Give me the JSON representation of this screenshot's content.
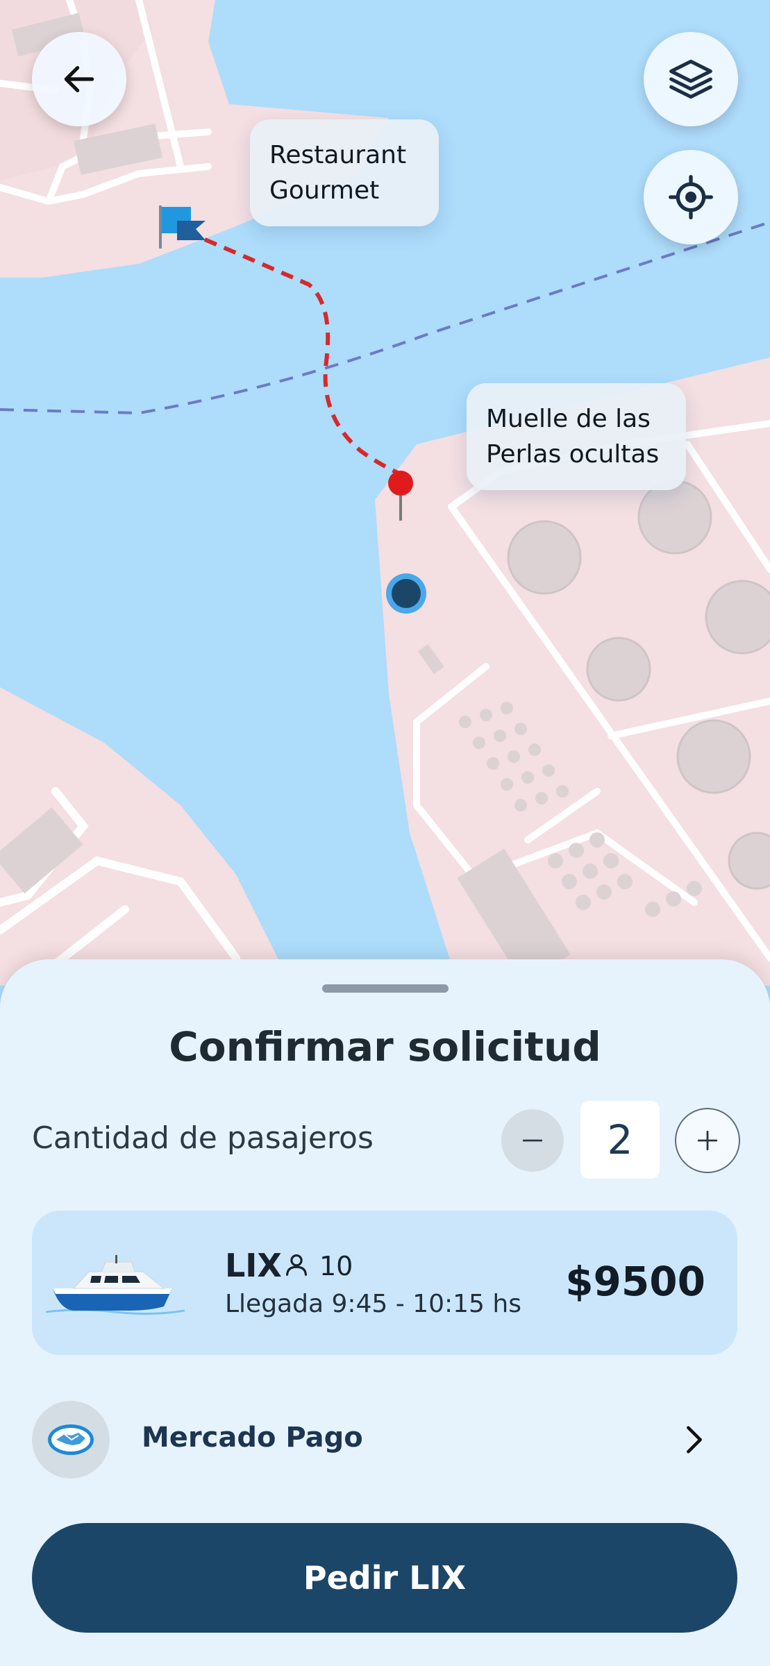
{
  "map": {
    "label_destination": [
      "Restaurant",
      "Gourmet"
    ],
    "label_origin": [
      "Muelle de las",
      "Perlas ocultas"
    ],
    "colors": {
      "water": "#aedcfb",
      "land": "#f4dfe2",
      "route": "#d62a2a",
      "pin": "#e01b1b",
      "user_dot": "#1c4668"
    }
  },
  "icons": {
    "back": "arrow-left-icon",
    "layers": "layers-icon",
    "locate": "crosshair-icon",
    "destination_flag": "flag-icon",
    "origin_pin": "map-pin-icon",
    "capacity": "person-icon",
    "payment": "handshake-icon",
    "chevron": "chevron-right-icon"
  },
  "sheet": {
    "title": "Confirmar solicitud",
    "passengers_label": "Cantidad de pasajeros",
    "passengers_count": "2",
    "ride": {
      "name": "LIX",
      "capacity": "10",
      "arrival": "Llegada 9:45 - 10:15 hs",
      "price": "$9500"
    },
    "payment_method": "Mercado Pago",
    "cta_label": "Pedir LIX"
  },
  "colors": {
    "accent": "#1c4668",
    "sheet_bg": "#e6f3fd",
    "card_bg": "#cbe6fb"
  }
}
